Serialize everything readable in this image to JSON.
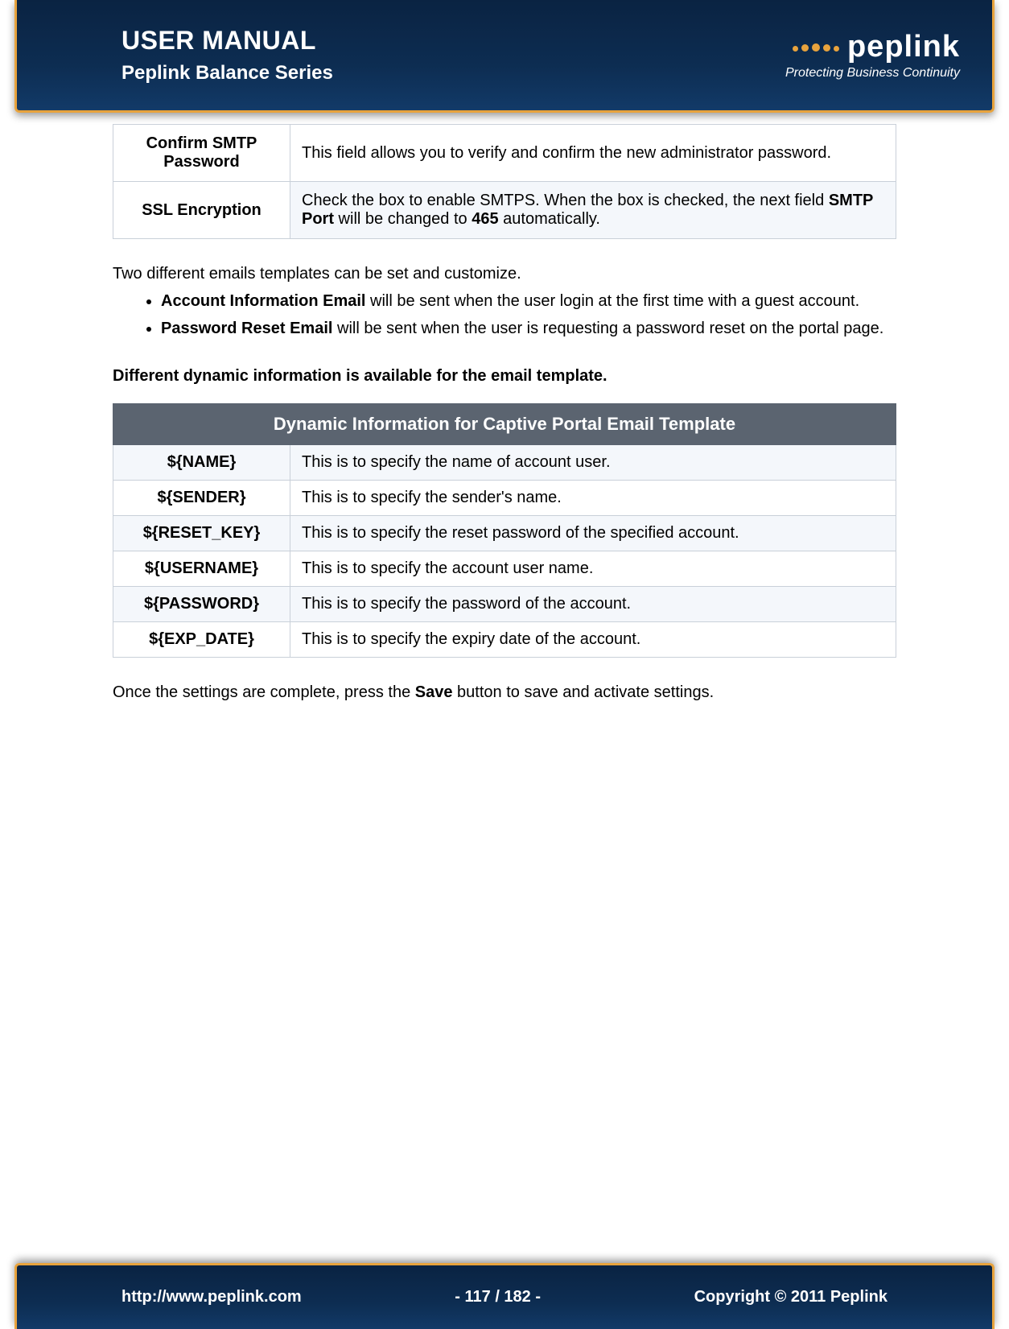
{
  "header": {
    "title": "USER MANUAL",
    "subtitle": "Peplink Balance Series",
    "logo_text": "peplink",
    "tagline": "Protecting Business Continuity"
  },
  "settings_table": {
    "rows": [
      {
        "label": "Confirm SMTP Password",
        "text": "This field allows you to verify and confirm the new administrator password."
      },
      {
        "label": "SSL Encryption",
        "text_pre": "Check the box to enable SMTPS.  When the box is checked, the next field ",
        "bold1": "SMTP Port",
        "mid": " will be changed to ",
        "bold2": "465",
        "text_post": " automatically."
      }
    ]
  },
  "para1": "Two different emails templates can be set and customize.",
  "bullets": [
    {
      "bold": "Account Information Email",
      "rest": " will be sent when the user login at the first time with a guest account."
    },
    {
      "bold": "Password Reset Email",
      "rest": " will be sent when the user is requesting a password reset on the portal page."
    }
  ],
  "section_heading": "Different dynamic information is available for the email template.",
  "dynamic_table": {
    "header": "Dynamic Information for Captive Portal Email Template",
    "rows": [
      {
        "var": "${NAME}",
        "desc": "This is to specify the name of account user."
      },
      {
        "var": "${SENDER}",
        "desc": "This is to specify the sender's name."
      },
      {
        "var": "${RESET_KEY}",
        "desc": "This is to specify the reset password of the specified account."
      },
      {
        "var": "${USERNAME}",
        "desc": "This is to specify the account user name."
      },
      {
        "var": "${PASSWORD}",
        "desc": "This is to specify the password of the account."
      },
      {
        "var": "${EXP_DATE}",
        "desc": "This is to specify the expiry date of the account."
      }
    ]
  },
  "closing": {
    "pre": "Once the settings are complete, press the ",
    "bold": "Save",
    "post": " button to save and activate settings."
  },
  "footer": {
    "url": "http://www.peplink.com",
    "page": "- 117 / 182 -",
    "copyright": "Copyright © 2011 Peplink"
  }
}
